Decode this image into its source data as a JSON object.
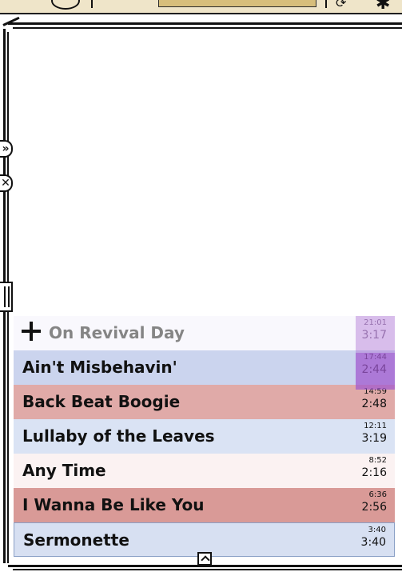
{
  "toolbar": {
    "icons": [
      "power-knob-icon",
      "title-field",
      "refresh-icon",
      "ink-blot-icon"
    ],
    "title_value": ""
  },
  "sidebar": {
    "forward_icon": "»",
    "close_icon": "✕",
    "handle_icon": "resize-handle-icon"
  },
  "playlist": {
    "next_track": {
      "title": "On Revival Day",
      "start": "21:01",
      "duration": "3:17",
      "color": "#f9f8fd"
    },
    "tracks": [
      {
        "title": "Ain't Misbehavin'",
        "start": "17:44",
        "duration": "2:44",
        "color": "#cbd4ee"
      },
      {
        "title": "Back Beat Boogie",
        "start": "14:59",
        "duration": "2:48",
        "color": "#e0aaa8"
      },
      {
        "title": "Lullaby of the Leaves",
        "start": "12:11",
        "duration": "3:19",
        "color": "#dae3f4"
      },
      {
        "title": "Any Time",
        "start": "8:52",
        "duration": "2:16",
        "color": "#fbf2f2"
      },
      {
        "title": "I Wanna Be Like You",
        "start": "6:36",
        "duration": "2:56",
        "color": "#d99a97"
      },
      {
        "title": "Sermonette",
        "start": "3:40",
        "duration": "3:40",
        "color": "#d7e0f2"
      }
    ],
    "progress_fraction": 0.5,
    "progress_color": "#a863d0"
  },
  "scroll": {
    "icon": "chevron-up-icon"
  }
}
